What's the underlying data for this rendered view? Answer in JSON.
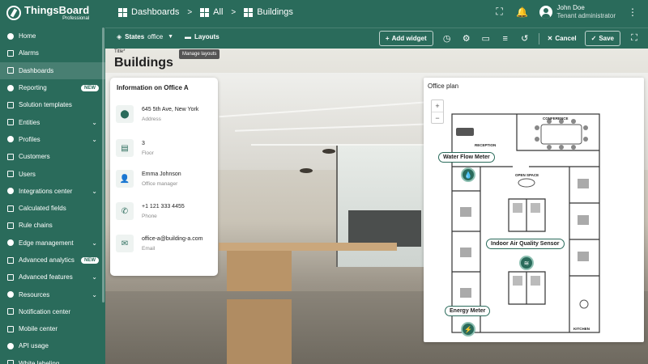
{
  "header": {
    "logo_title": "ThingsBoard",
    "logo_subtitle": "Professional",
    "breadcrumbs": [
      "Dashboards",
      "All",
      "Buildings"
    ],
    "user_name": "John Doe",
    "user_role": "Tenant administrator"
  },
  "sidebar": {
    "items": [
      {
        "label": "Home",
        "icon": "home-icon",
        "has_chevron": false
      },
      {
        "label": "Alarms",
        "icon": "alarm-icon",
        "has_chevron": false
      },
      {
        "label": "Dashboards",
        "icon": "dashboard-icon",
        "has_chevron": false,
        "active": true
      },
      {
        "label": "Reporting",
        "icon": "report-icon",
        "badge": "NEW"
      },
      {
        "label": "Solution templates",
        "icon": "template-icon"
      },
      {
        "label": "Entities",
        "icon": "entities-icon",
        "has_chevron": true
      },
      {
        "label": "Profiles",
        "icon": "profiles-icon",
        "has_chevron": true
      },
      {
        "label": "Customers",
        "icon": "customers-icon"
      },
      {
        "label": "Users",
        "icon": "users-icon"
      },
      {
        "label": "Integrations center",
        "icon": "integrations-icon",
        "has_chevron": true
      },
      {
        "label": "Calculated fields",
        "icon": "calculated-fields-icon"
      },
      {
        "label": "Rule chains",
        "icon": "rule-chains-icon"
      },
      {
        "label": "Edge management",
        "icon": "edge-icon",
        "has_chevron": true
      },
      {
        "label": "Advanced analytics",
        "icon": "analytics-icon",
        "badge": "NEW"
      },
      {
        "label": "Advanced features",
        "icon": "features-icon",
        "has_chevron": true
      },
      {
        "label": "Resources",
        "icon": "resources-icon",
        "has_chevron": true
      },
      {
        "label": "Notification center",
        "icon": "notification-icon"
      },
      {
        "label": "Mobile center",
        "icon": "mobile-icon"
      },
      {
        "label": "API usage",
        "icon": "api-icon"
      },
      {
        "label": "White labeling",
        "icon": "white-label-icon"
      }
    ]
  },
  "toolbar": {
    "states_label": "States",
    "states_value": "office",
    "layouts_label": "Layouts",
    "layouts_tooltip": "Manage layouts",
    "add_widget_label": "Add widget",
    "cancel_label": "Cancel",
    "save_label": "Save"
  },
  "dashboard": {
    "title_label": "Title*",
    "title": "Buildings"
  },
  "info_card": {
    "title": "Information on Office A",
    "rows": [
      {
        "icon": "location-icon",
        "value": "645 5th Ave, New York",
        "label": "Address"
      },
      {
        "icon": "floor-icon",
        "value": "3",
        "label": "Floor"
      },
      {
        "icon": "person-icon",
        "value": "Emma Johnson",
        "label": "Office manager"
      },
      {
        "icon": "phone-icon",
        "value": "+1 121 333 4455",
        "label": "Phone"
      },
      {
        "icon": "email-icon",
        "value": "office-a@building-a.com",
        "label": "Email"
      }
    ]
  },
  "office_plan": {
    "title": "Office plan",
    "room_labels": [
      "CONFERENCE",
      "RECEPTION",
      "OPEN SPACE",
      "KITCHEN"
    ],
    "markers": [
      {
        "label": "Water Flow Meter"
      },
      {
        "label": "Indoor Air Quality Sensor"
      },
      {
        "label": "Energy Meter"
      }
    ]
  },
  "colors": {
    "brand": "#2a6b5b",
    "marker_ring": "#8fc1b3"
  }
}
